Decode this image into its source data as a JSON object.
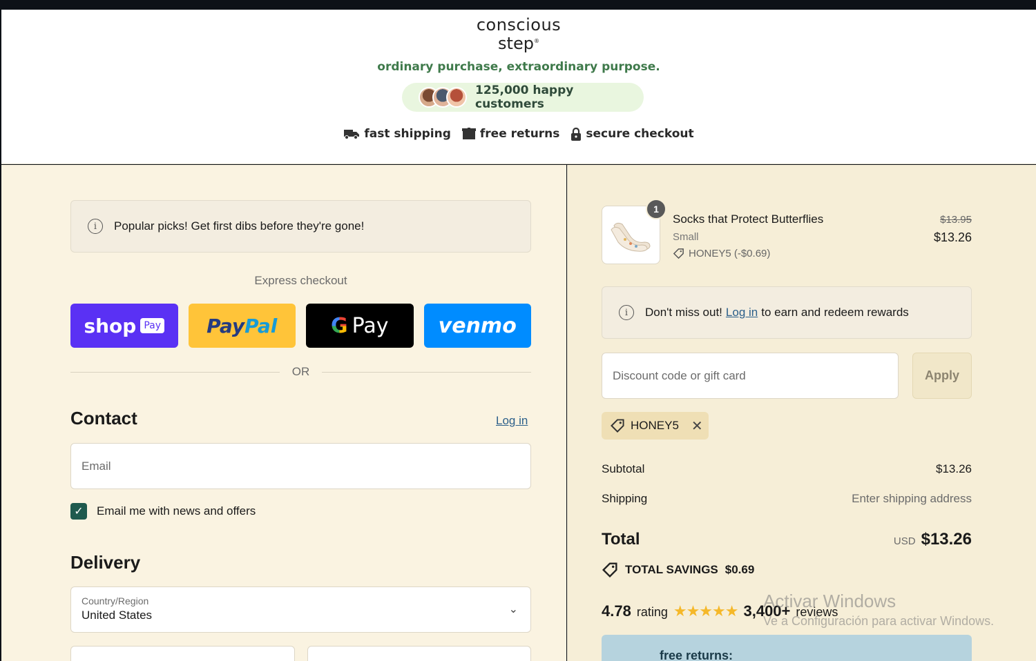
{
  "header": {
    "logo_line1": "conscious",
    "logo_line2": "step",
    "tagline": "ordinary purchase, extraordinary purpose.",
    "customers": "125,000 happy customers",
    "badges": [
      {
        "label": "fast shipping",
        "icon": "truck-icon"
      },
      {
        "label": "free returns",
        "icon": "box-icon"
      },
      {
        "label": "secure checkout",
        "icon": "lock-icon"
      }
    ]
  },
  "checkout": {
    "notice": "Popular picks! Get first dibs before they're gone!",
    "express_label": "Express checkout",
    "pay_buttons": {
      "shop": "shop",
      "shop_tag": "Pay",
      "paypal_a": "Pay",
      "paypal_b": "Pal",
      "gpay": "Pay",
      "venmo": "venmo"
    },
    "or": "OR",
    "contact": {
      "heading": "Contact",
      "login": "Log in",
      "email_placeholder": "Email",
      "newsletter_label": "Email me with news and offers",
      "newsletter_checked": true
    },
    "delivery": {
      "heading": "Delivery",
      "country_label": "Country/Region",
      "country_value": "United States"
    }
  },
  "summary": {
    "product": {
      "quantity": "1",
      "title": "Socks that Protect Butterflies",
      "variant": "Small",
      "discount": "HONEY5 (-$0.69)",
      "price_old": "$13.95",
      "price_new": "$13.26"
    },
    "rewards_notice": {
      "before": "Don't miss out!",
      "link": "Log in",
      "after": "to earn and redeem rewards"
    },
    "discount_placeholder": "Discount code or gift card",
    "apply_label": "Apply",
    "applied_code": "HONEY5",
    "subtotal_label": "Subtotal",
    "subtotal_value": "$13.26",
    "shipping_label": "Shipping",
    "shipping_value": "Enter shipping address",
    "total_label": "Total",
    "currency": "USD",
    "total_value": "$13.26",
    "savings_label": "TOTAL SAVINGS",
    "savings_value": "$0.69",
    "rating_value": "4.78",
    "rating_word": "rating",
    "stars": 5,
    "reviews_count": "3,400+",
    "reviews_word": "reviews",
    "promo_title": "free returns:"
  },
  "os_watermark": {
    "line1": "Activar Windows",
    "line2": "Ve a Configuración para activar Windows."
  },
  "colors": {
    "left_bg": "#faf3e1",
    "right_bg": "#f6eed7",
    "tagline_green": "#3f7a4b",
    "shop_pay": "#5a31f4",
    "paypal": "#ffc439",
    "venmo": "#008cff",
    "checkbox": "#1f5a4e"
  }
}
